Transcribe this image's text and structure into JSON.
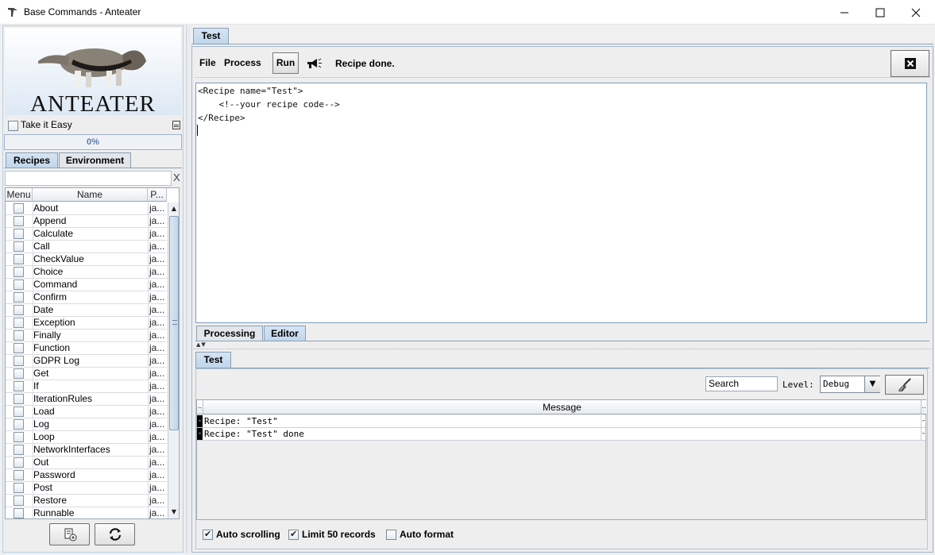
{
  "window": {
    "title": "Base Commands - Anteater",
    "minimize": "—",
    "maximize": "☐",
    "close": "✕"
  },
  "left": {
    "logo_text": "ANTEATER",
    "take_it_easy": "Take it Easy",
    "progress": "0%",
    "tabs": [
      {
        "label": "Recipes",
        "active": true
      },
      {
        "label": "Environment",
        "active": false
      }
    ],
    "filter": {
      "value": "",
      "clear": "X"
    },
    "columns": {
      "menu": "Menu",
      "name": "Name",
      "p": "P..."
    },
    "recipes": [
      {
        "name": "About",
        "p": "ja..."
      },
      {
        "name": "Append",
        "p": "ja..."
      },
      {
        "name": "Calculate",
        "p": "ja..."
      },
      {
        "name": "Call",
        "p": "ja..."
      },
      {
        "name": "CheckValue",
        "p": "ja..."
      },
      {
        "name": "Choice",
        "p": "ja..."
      },
      {
        "name": "Command",
        "p": "ja..."
      },
      {
        "name": "Confirm",
        "p": "ja..."
      },
      {
        "name": "Date",
        "p": "ja..."
      },
      {
        "name": "Exception",
        "p": "ja..."
      },
      {
        "name": "Finally",
        "p": "ja..."
      },
      {
        "name": "Function",
        "p": "ja..."
      },
      {
        "name": "GDPR Log",
        "p": "ja..."
      },
      {
        "name": "Get",
        "p": "ja..."
      },
      {
        "name": "If",
        "p": "ja..."
      },
      {
        "name": "IterationRules",
        "p": "ja..."
      },
      {
        "name": "Load",
        "p": "ja..."
      },
      {
        "name": "Log",
        "p": "ja..."
      },
      {
        "name": "Loop",
        "p": "ja..."
      },
      {
        "name": "NetworkInterfaces",
        "p": "ja..."
      },
      {
        "name": "Out",
        "p": "ja..."
      },
      {
        "name": "Password",
        "p": "ja..."
      },
      {
        "name": "Post",
        "p": "ja..."
      },
      {
        "name": "Restore",
        "p": "ja..."
      },
      {
        "name": "Runnable",
        "p": "ja..."
      }
    ]
  },
  "right": {
    "tab": "Test",
    "menu": {
      "file": "File",
      "process": "Process"
    },
    "run_label": "Run",
    "status": "Recipe done.",
    "code_lines": [
      "<Recipe name=\"Test\">",
      "    <!--your recipe code-->",
      "</Recipe>"
    ],
    "bottom_tabs": {
      "processing": "Processing",
      "editor": "Editor"
    },
    "log": {
      "tab": "Test",
      "search_value": "Search",
      "level_label": "Level:",
      "level_value": "Debug",
      "column_left": "..",
      "column_message": "Message",
      "column_right": "..",
      "rows": [
        {
          "mark": "-",
          "message": "Recipe: \"Test\"",
          "end": "-"
        },
        {
          "mark": "-",
          "message": "Recipe: \"Test\" done",
          "end": "-"
        }
      ],
      "options": [
        {
          "label": "Auto scrolling",
          "checked": true
        },
        {
          "label": "Limit 50 records",
          "checked": true
        },
        {
          "label": "Auto format",
          "checked": false
        }
      ]
    }
  }
}
